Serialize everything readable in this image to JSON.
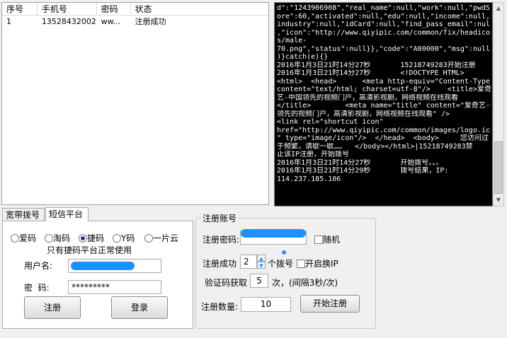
{
  "table": {
    "headers": [
      "序号",
      "手机号",
      "密码",
      "状态"
    ],
    "rows": [
      {
        "index": "1",
        "phone": "13528432002",
        "password": "ww...",
        "status": "注册成功"
      }
    ]
  },
  "console": {
    "lines": [
      "d\":\"1243906908\",\"real_name\":null,\"work\":null,\"pwdSc",
      "ore\":60,\"activated\":null,\"edu\":null,\"income\":null,\"",
      "industry\":null,\"idCard\":null,\"find_pass_email\":null",
      ",\"icon\":\"http://www.qiyipic.com/common/fix/headicon",
      "s/male-",
      "70.png\",\"status\":null}},\"code\":\"A00000\",\"msg\":null}",
      ")}catch(e){}",
      "2016年1月3日21时14分27秒       15218749283开始注册",
      "2016年1月3日21时14分27秒       <!DOCTYPE HTML>",
      "<html>  <head>      <meta http-equiv=\"Content-Type\"",
      "content=\"text/html; charset=utf-8\"/>    <title>爱奇",
      "艺-中国领先的视频门户，高清影视剧，网络视频在线观看",
      "</title>        <meta name=\"title\" content=\"爱奇艺-中国",
      "领先的视频门户，高清影视剧，网络视频在线观看\" />",
      "<link rel=\"shortcut icon\"",
      "href=\"http://www.qiyipic.com/common/images/logo.ico",
      "\" type=\"image/icon\"/>  </head>  <body>     您访问过",
      "于频繁，请歇一歇……   </body></html>|15218749283禁",
      "止该IP注册，开始拨号",
      "2016年1月3日21时14分27秒       开始拨号。。。",
      "2016年1月3日21时14分29秒       拨号结果，IP:",
      "114.237.185.106"
    ]
  },
  "tabs": [
    "宽带拨号",
    "短信平台"
  ],
  "sms": {
    "platforms": [
      "爱码",
      "淘码",
      "捷码",
      "Y码",
      "一片云"
    ],
    "selected": "捷码",
    "notice": "只有捷码平台正常使用",
    "username_label": "用户名:",
    "password_label": "密  码:",
    "password_value": "*********",
    "register_button": "注册",
    "login_button": "登录"
  },
  "account": {
    "group_title": "注册账号",
    "password_label": "注册密码:",
    "random_label": "随机",
    "success_label": "注册成功",
    "success_count": "2",
    "dial_label": "个拨号",
    "ip_switch_label": "开启换IP",
    "captcha_label": "验证码获取",
    "captcha_count": "5",
    "captcha_suffix": "次，(间隔3秒/次)",
    "count_label": "注册数量:",
    "count_value": "10",
    "start_button": "开始注册"
  },
  "colors": {
    "redaction": "#1e90ff",
    "console_bg": "#000000"
  }
}
